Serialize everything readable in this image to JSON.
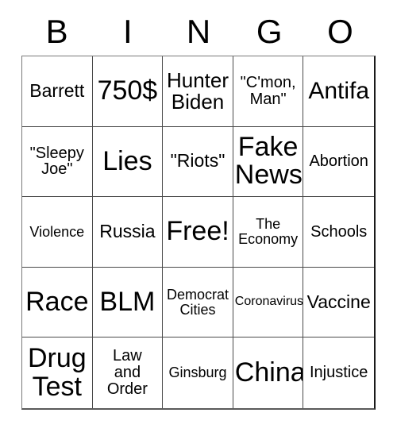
{
  "card": {
    "header_letters": [
      "B",
      "I",
      "N",
      "G",
      "O"
    ],
    "colors": {
      "background": "#ffffff",
      "text": "#000000",
      "grid_line": "#4a4a4a",
      "outer_border": "#1a1a1a"
    },
    "rows": [
      [
        {
          "text": "Barrett",
          "size": "md"
        },
        {
          "text": "750$",
          "size": "xxl"
        },
        {
          "text": "Hunter\nBiden",
          "size": "lg"
        },
        {
          "text": "\"C'mon,\nMan\"",
          "size": "sm"
        },
        {
          "text": "Antifa",
          "size": "xl"
        }
      ],
      [
        {
          "text": "\"Sleepy\nJoe\"",
          "size": "sm"
        },
        {
          "text": "Lies",
          "size": "xxl"
        },
        {
          "text": "\"Riots\"",
          "size": "md"
        },
        {
          "text": "Fake\nNews",
          "size": "xxl"
        },
        {
          "text": "Abortion",
          "size": "sm"
        }
      ],
      [
        {
          "text": "Violence",
          "size": "xs"
        },
        {
          "text": "Russia",
          "size": "md"
        },
        {
          "text": "Free!",
          "size": "xxl"
        },
        {
          "text": "The\nEconomy",
          "size": "xs"
        },
        {
          "text": "Schools",
          "size": "sm"
        }
      ],
      [
        {
          "text": "Race",
          "size": "xxl"
        },
        {
          "text": "BLM",
          "size": "xxl"
        },
        {
          "text": "Democrat\nCities",
          "size": "xs"
        },
        {
          "text": "Coronavirus",
          "size": "xxs"
        },
        {
          "text": "Vaccine",
          "size": "md"
        }
      ],
      [
        {
          "text": "Drug\nTest",
          "size": "xxl"
        },
        {
          "text": "Law\nand\nOrder",
          "size": "sm"
        },
        {
          "text": "Ginsburg",
          "size": "xs"
        },
        {
          "text": "China",
          "size": "xxl"
        },
        {
          "text": "Injustice",
          "size": "sm"
        }
      ]
    ]
  }
}
